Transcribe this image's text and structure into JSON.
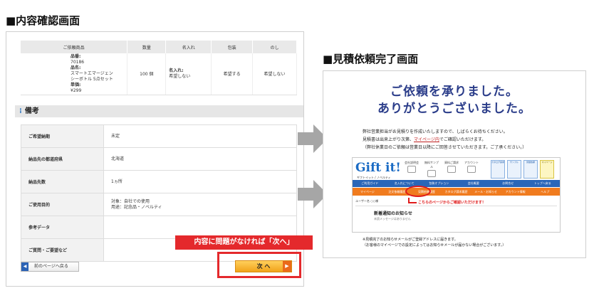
{
  "left_title": "■内容確認画面",
  "right_title": "■見積依頼完了画面",
  "order_table": {
    "headers": [
      "ご依頼商品",
      "数量",
      "名入れ",
      "包装",
      "のし"
    ],
    "row": {
      "product_lines": [
        "品番:",
        "70186",
        "品名:",
        "スマートエマージェン",
        "シーボトル 5点セット",
        "単価:",
        "¥299"
      ],
      "quantity": "100 個",
      "naire_lines": [
        "名入れ:",
        "希望しない"
      ],
      "wrap": "希望する",
      "noshi": "希望しない"
    }
  },
  "section_title": "備考",
  "memo_rows": [
    {
      "key": "ご希望納期",
      "lines": [
        "未定"
      ]
    },
    {
      "key": "納品先の都道府県",
      "lines": [
        "北海道"
      ]
    },
    {
      "key": "納品先数",
      "lines": [
        "1ヵ所"
      ]
    },
    {
      "key": "ご使用目的",
      "lines": [
        "対象：自社での使用",
        "用途：記念品・ノベルティ"
      ]
    },
    {
      "key": "参考データ",
      "lines": [
        ""
      ]
    },
    {
      "key": "ご質問・ご要望など",
      "lines": [
        ""
      ]
    }
  ],
  "back_button": "前のページへ戻る",
  "callout": "内容に問題がなければ「次へ」",
  "next_button": "次 へ",
  "done": {
    "heading1": "ご依頼を承りました。",
    "heading2": "ありがとうございました。",
    "body1": "弊社営業担当がお見積りを作成いたしますので、しばらくお待ちください。",
    "body2_pre": "見積書は出来上がり次第、",
    "body2_link": "マイページ内",
    "body2_post": "でご確認いただけます。",
    "body3": "（弊社休業日のご依頼は営業日以降にご回答させていただきます。ご了承ください。）",
    "foot1": "※見積完了のお知らせメールがご登録アドレスに届きます。",
    "foot2": "（お客様のマイページでの設定によってはお知らせメールが届かない場合がございます。）"
  },
  "mini_site": {
    "logo": "Gift it!",
    "logo_sub": "ギフトイット / ノベルティ",
    "top_icons": [
      "会社説明会",
      "無料サンプル",
      "資料ご請求",
      "アカウント"
    ],
    "side_icons": [
      "カタログ請求",
      "サンプル",
      "見積依頼",
      "マイページ"
    ],
    "nav_blue": [
      "ご利用ガイド",
      "名入れについて",
      "包装オプション",
      "会社概要",
      "お問合せ",
      "トップへ戻る"
    ],
    "nav_orange": [
      "マイページ",
      "注文依頼履歴",
      "見積依頼履歴",
      "カタログ請求履歴",
      "メール・お知らせ",
      "アカウント情報",
      "ヘルプ"
    ],
    "user_text": "ユーザー名 ○○様",
    "hint": "こちらのページからご確認いただけます！",
    "news_title": "新着通知のお知らせ",
    "news_sub": "未読メッセージはありません"
  }
}
